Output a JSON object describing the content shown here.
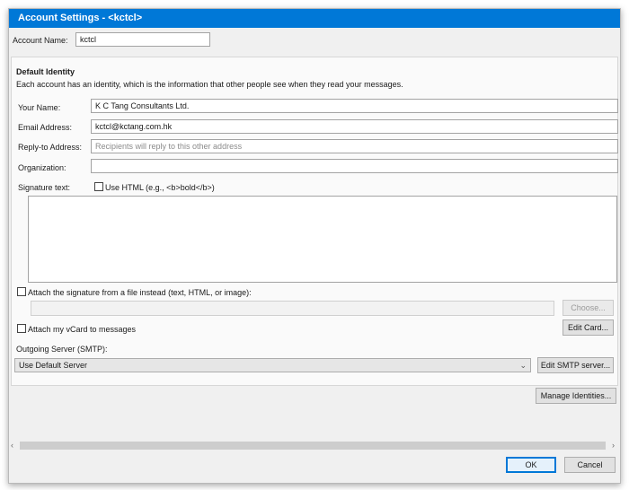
{
  "window": {
    "title": "Account Settings - <kctcl>"
  },
  "account": {
    "name_label": "Account Name:",
    "name_value": "kctcl"
  },
  "identity": {
    "heading": "Default Identity",
    "description": "Each account has an identity, which is the information that other people see when they read your messages.",
    "your_name_label": "Your Name:",
    "your_name_value": "K C Tang Consultants Ltd.",
    "email_label": "Email Address:",
    "email_value": "kctcl@kctang.com.hk",
    "reply_to_label": "Reply-to Address:",
    "reply_to_placeholder": "Recipients will reply to this other address",
    "org_label": "Organization:",
    "org_value": "",
    "signature_label": "Signature text:",
    "use_html_label": "Use HTML (e.g., <b>bold</b>)",
    "signature_value": "",
    "attach_sig_label": "Attach the signature from a file instead (text, HTML, or image):",
    "choose_label": "Choose...",
    "vcard_label": "Attach my vCard to messages",
    "edit_card_label": "Edit Card...",
    "smtp_label": "Outgoing Server (SMTP):",
    "smtp_selected": "Use Default Server",
    "edit_smtp_label": "Edit SMTP server...",
    "manage_identities_label": "Manage Identities..."
  },
  "footer": {
    "ok_label": "OK",
    "cancel_label": "Cancel"
  },
  "icons": {
    "dropdown": "chevron-down-icon",
    "scroll_left": "scroll-left-icon",
    "scroll_right": "scroll-right-icon"
  }
}
